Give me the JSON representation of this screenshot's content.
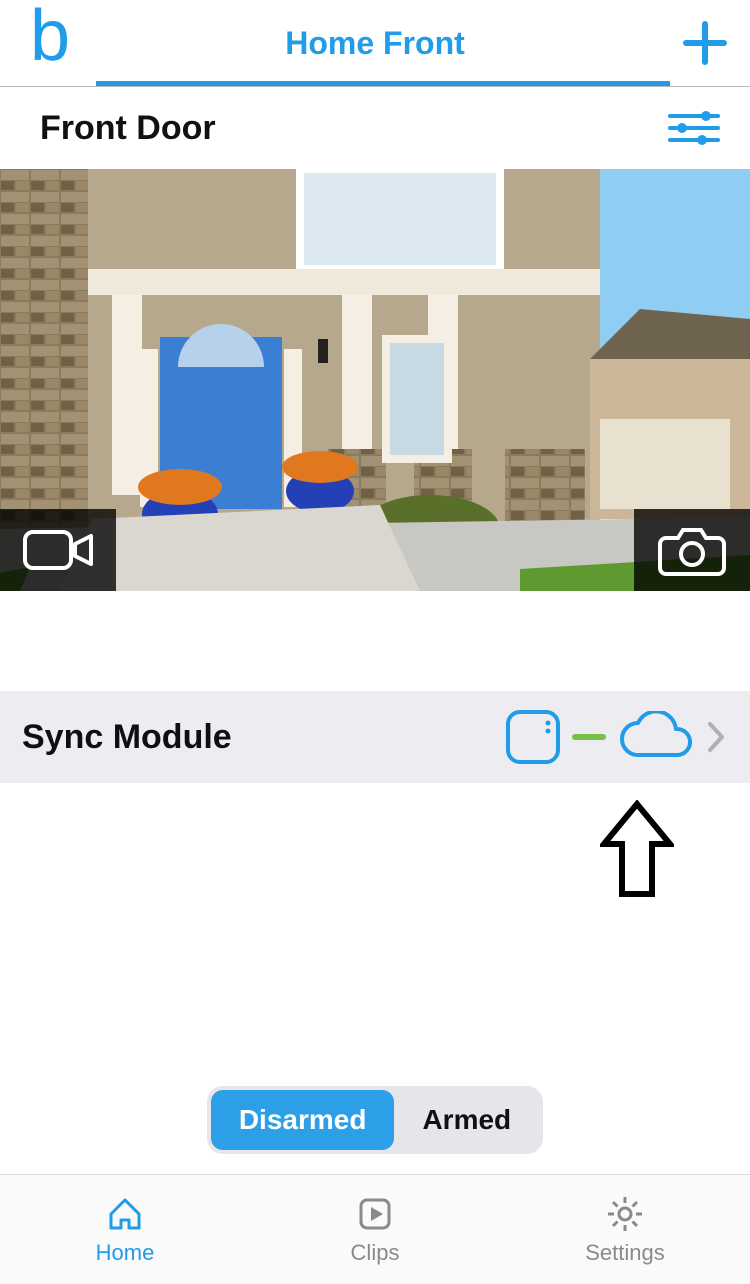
{
  "header": {
    "logo_letter": "b",
    "system_name": "Home Front"
  },
  "camera": {
    "title": "Front Door"
  },
  "sync": {
    "label": "Sync Module"
  },
  "segment": {
    "disarmed": "Disarmed",
    "armed": "Armed",
    "active": "disarmed"
  },
  "tabs": {
    "home": "Home",
    "clips": "Clips",
    "settings": "Settings",
    "active": "home"
  },
  "colors": {
    "brand_blue": "#209ce9",
    "connected_green": "#76c043"
  }
}
